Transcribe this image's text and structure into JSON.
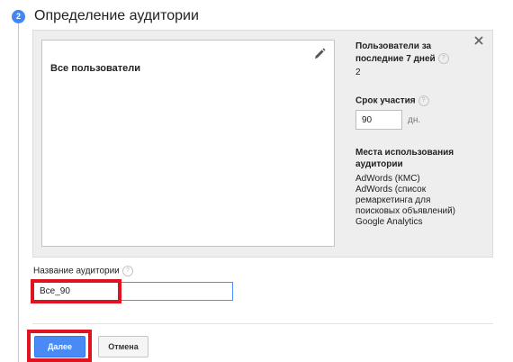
{
  "step": {
    "number": "2",
    "title": "Определение аудитории"
  },
  "segment": {
    "name": "Все пользователи"
  },
  "side": {
    "users_label": "Пользователи за последние 7 дней",
    "users_value": "2",
    "duration_label": "Срок участия",
    "duration_value": "90",
    "duration_unit": "дн.",
    "destinations_label": "Места использования аудитории",
    "destinations": [
      "AdWords (КМС)",
      "AdWords (список ремаркетинга для поисковых объявлений)",
      "Google Analytics"
    ]
  },
  "audience_name": {
    "label": "Название аудитории",
    "value": "Все_90"
  },
  "buttons": {
    "next": "Далее",
    "cancel": "Отмена"
  },
  "help_glyph": "?",
  "colors": {
    "accent": "#4285f4",
    "highlight": "#e0141e"
  }
}
